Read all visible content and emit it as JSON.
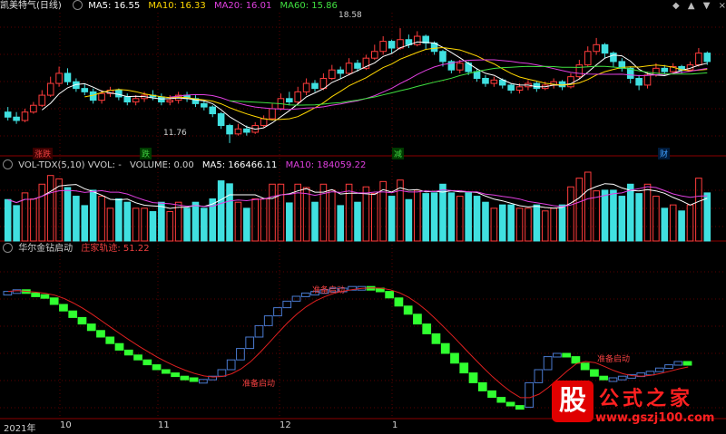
{
  "window": {
    "toolbar_icons": [
      "◆",
      "▲",
      "▼",
      "×"
    ]
  },
  "main_panel": {
    "title": "凯美特气(日线)",
    "ma": [
      {
        "label": "MA5: 16.55",
        "color": "#ffffff"
      },
      {
        "label": "MA10: 16.33",
        "color": "#ffd700"
      },
      {
        "label": "MA20: 16.01",
        "color": "#e040e0"
      },
      {
        "label": "MA60: 15.86",
        "color": "#40e040"
      }
    ],
    "high_label": "18.58",
    "low_label": "11.76",
    "event_tags": [
      {
        "text": "涨跌",
        "color": "#f04040"
      },
      {
        "text": "跌",
        "color": "#40d040"
      },
      {
        "text": "减",
        "color": "#40d040"
      },
      {
        "text": "财",
        "color": "#40a0ff"
      }
    ]
  },
  "volume_panel": {
    "title": "VOL-TDX(5,10) VVOL: -",
    "volume": "VOLUME: 0.00",
    "ma5": "MA5: 166466.11",
    "ma10": "MA10: 184059.22",
    "colors": {
      "volume": "#c0c0c0",
      "ma5": "#ffffff",
      "ma10": "#e040e0"
    }
  },
  "indicator_panel": {
    "title": "华尔金钻启动",
    "trail": "庄家轨迹: 51.22",
    "signal_label": "准备启动"
  },
  "x_axis": {
    "labels": [
      "2021年",
      "10",
      "11",
      "12",
      "1"
    ]
  },
  "watermark": {
    "logo": "股",
    "title": "公式之家",
    "url": "www.gszj100.com"
  },
  "chart_data": {
    "type": "candlestick",
    "price_range": [
      11,
      19.5
    ],
    "candles": [
      [
        13.6,
        13.3,
        13.9,
        13.1
      ],
      [
        13.3,
        13.1,
        13.6,
        12.9
      ],
      [
        13.1,
        13.6,
        13.8,
        13.0
      ],
      [
        13.6,
        14.0,
        14.2,
        13.5
      ],
      [
        14.0,
        14.6,
        14.9,
        13.9
      ],
      [
        14.6,
        15.3,
        15.7,
        14.5
      ],
      [
        15.3,
        15.9,
        16.3,
        15.1
      ],
      [
        15.9,
        15.4,
        16.2,
        15.2
      ],
      [
        15.4,
        15.0,
        15.6,
        14.8
      ],
      [
        15.0,
        14.8,
        15.3,
        14.6
      ],
      [
        14.8,
        14.3,
        15.0,
        14.1
      ],
      [
        14.3,
        14.7,
        14.9,
        14.1
      ],
      [
        14.7,
        14.9,
        15.1,
        14.5
      ],
      [
        14.9,
        14.5,
        15.0,
        14.3
      ],
      [
        14.5,
        14.2,
        14.7,
        14.0
      ],
      [
        14.2,
        14.4,
        14.6,
        14.0
      ],
      [
        14.4,
        14.6,
        14.8,
        14.2
      ],
      [
        14.6,
        14.5,
        14.9,
        14.3
      ],
      [
        14.5,
        14.2,
        14.7,
        14.0
      ],
      [
        14.2,
        14.3,
        14.6,
        14.0
      ],
      [
        14.3,
        14.6,
        14.8,
        14.1
      ],
      [
        14.6,
        14.4,
        14.8,
        14.2
      ],
      [
        14.4,
        14.1,
        14.6,
        13.9
      ],
      [
        14.1,
        13.9,
        14.3,
        13.7
      ],
      [
        13.9,
        13.5,
        14.0,
        13.3
      ],
      [
        13.5,
        12.8,
        13.6,
        12.6
      ],
      [
        12.8,
        12.3,
        12.9,
        11.76
      ],
      [
        12.3,
        12.6,
        12.9,
        12.2
      ],
      [
        12.6,
        12.4,
        12.8,
        12.2
      ],
      [
        12.4,
        12.8,
        13.0,
        12.3
      ],
      [
        12.8,
        13.2,
        13.4,
        12.7
      ],
      [
        13.2,
        13.8,
        14.1,
        13.1
      ],
      [
        13.8,
        14.4,
        14.7,
        13.7
      ],
      [
        14.4,
        14.2,
        14.8,
        14.0
      ],
      [
        14.2,
        14.8,
        15.1,
        14.1
      ],
      [
        14.8,
        15.3,
        15.6,
        14.6
      ],
      [
        15.3,
        15.0,
        15.5,
        14.8
      ],
      [
        15.0,
        15.6,
        15.9,
        14.9
      ],
      [
        15.6,
        16.1,
        16.4,
        15.5
      ],
      [
        16.1,
        15.9,
        16.3,
        15.6
      ],
      [
        15.9,
        16.5,
        16.8,
        15.8
      ],
      [
        16.5,
        16.2,
        16.7,
        16.0
      ],
      [
        16.2,
        16.8,
        17.0,
        16.1
      ],
      [
        16.8,
        17.2,
        17.6,
        16.7
      ],
      [
        17.2,
        17.8,
        18.1,
        17.0
      ],
      [
        17.8,
        17.4,
        17.9,
        17.1
      ],
      [
        17.4,
        17.9,
        18.58,
        17.3
      ],
      [
        17.9,
        17.6,
        18.2,
        17.4
      ],
      [
        17.6,
        18.1,
        18.4,
        17.5
      ],
      [
        18.1,
        17.7,
        18.2,
        17.3
      ],
      [
        17.7,
        17.2,
        17.8,
        17.0
      ],
      [
        17.2,
        16.6,
        17.3,
        16.3
      ],
      [
        16.6,
        16.1,
        16.7,
        15.9
      ],
      [
        16.1,
        16.5,
        16.7,
        15.9
      ],
      [
        16.5,
        16.0,
        16.6,
        15.8
      ],
      [
        16.0,
        15.6,
        16.2,
        15.4
      ],
      [
        15.6,
        15.3,
        15.8,
        15.1
      ],
      [
        15.3,
        15.5,
        15.7,
        15.1
      ],
      [
        15.5,
        15.2,
        15.6,
        15.0
      ],
      [
        15.2,
        14.9,
        15.3,
        14.7
      ],
      [
        14.9,
        15.1,
        15.3,
        14.7
      ],
      [
        15.1,
        15.3,
        15.5,
        14.9
      ],
      [
        15.3,
        15.0,
        15.4,
        14.8
      ],
      [
        15.0,
        15.2,
        15.4,
        14.9
      ],
      [
        15.2,
        15.4,
        15.6,
        15.0
      ],
      [
        15.4,
        15.1,
        15.5,
        14.9
      ],
      [
        15.1,
        15.7,
        15.9,
        15.0
      ],
      [
        15.7,
        16.4,
        16.7,
        15.6
      ],
      [
        16.4,
        17.2,
        17.5,
        16.3
      ],
      [
        17.2,
        17.6,
        18.0,
        17.0
      ],
      [
        17.6,
        17.1,
        17.7,
        16.8
      ],
      [
        17.1,
        16.6,
        17.2,
        16.3
      ],
      [
        16.6,
        16.2,
        16.8,
        16.0
      ],
      [
        16.2,
        15.6,
        16.3,
        15.3
      ],
      [
        15.6,
        15.2,
        15.8,
        14.9
      ],
      [
        15.2,
        15.8,
        16.0,
        15.0
      ],
      [
        15.8,
        16.2,
        16.5,
        15.7
      ],
      [
        16.2,
        16.0,
        16.4,
        15.8
      ],
      [
        16.0,
        16.3,
        16.5,
        15.9
      ],
      [
        16.3,
        16.1,
        16.4,
        15.9
      ],
      [
        16.1,
        16.4,
        16.6,
        16.0
      ],
      [
        16.4,
        17.1,
        17.4,
        16.3
      ],
      [
        17.1,
        16.6,
        17.2,
        16.4
      ]
    ],
    "indicator": [
      78,
      79,
      77,
      76,
      74,
      70,
      66,
      62,
      58,
      54,
      50,
      46,
      42,
      39,
      36,
      33,
      30,
      28,
      26,
      25,
      24,
      24,
      26,
      30,
      36,
      43,
      50,
      57,
      63,
      68,
      72,
      75,
      77,
      78,
      79,
      80,
      80,
      81,
      81,
      80,
      78,
      74,
      69,
      64,
      58,
      52,
      46,
      40,
      34,
      28,
      22,
      17,
      13,
      10,
      8,
      7,
      22,
      30,
      38,
      40,
      38,
      34,
      30,
      26,
      24,
      25,
      26,
      27,
      28,
      29,
      31,
      33,
      35,
      34
    ]
  }
}
